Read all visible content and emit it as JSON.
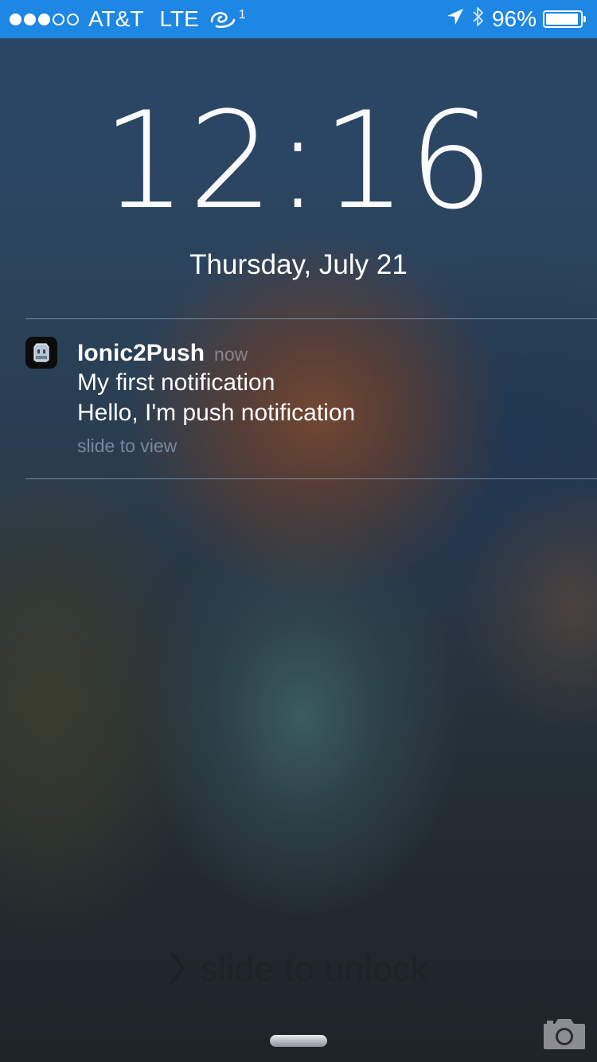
{
  "status_bar": {
    "signal_bars_filled": 3,
    "signal_bars_total": 5,
    "carrier": "AT&T",
    "network": "LTE",
    "wifi_calling_badge": "1",
    "battery_percent": "96%",
    "battery_level": 0.96,
    "background_color": "#1e86e3",
    "icons": [
      "wifi-calling-icon",
      "location-arrow-icon",
      "bluetooth-icon",
      "battery-icon"
    ]
  },
  "lock_screen": {
    "time": "12:16",
    "date": "Thursday, July 21"
  },
  "notification": {
    "app_name": "Ionic2Push",
    "time": "now",
    "title": "My first notification",
    "body": "Hello, I'm push notification",
    "action": "slide to view",
    "icon": "cordova-app-icon"
  },
  "unlock": {
    "label": "slide to unlock",
    "icon": "chevron-right-icon"
  },
  "camera": {
    "icon": "camera-icon"
  }
}
